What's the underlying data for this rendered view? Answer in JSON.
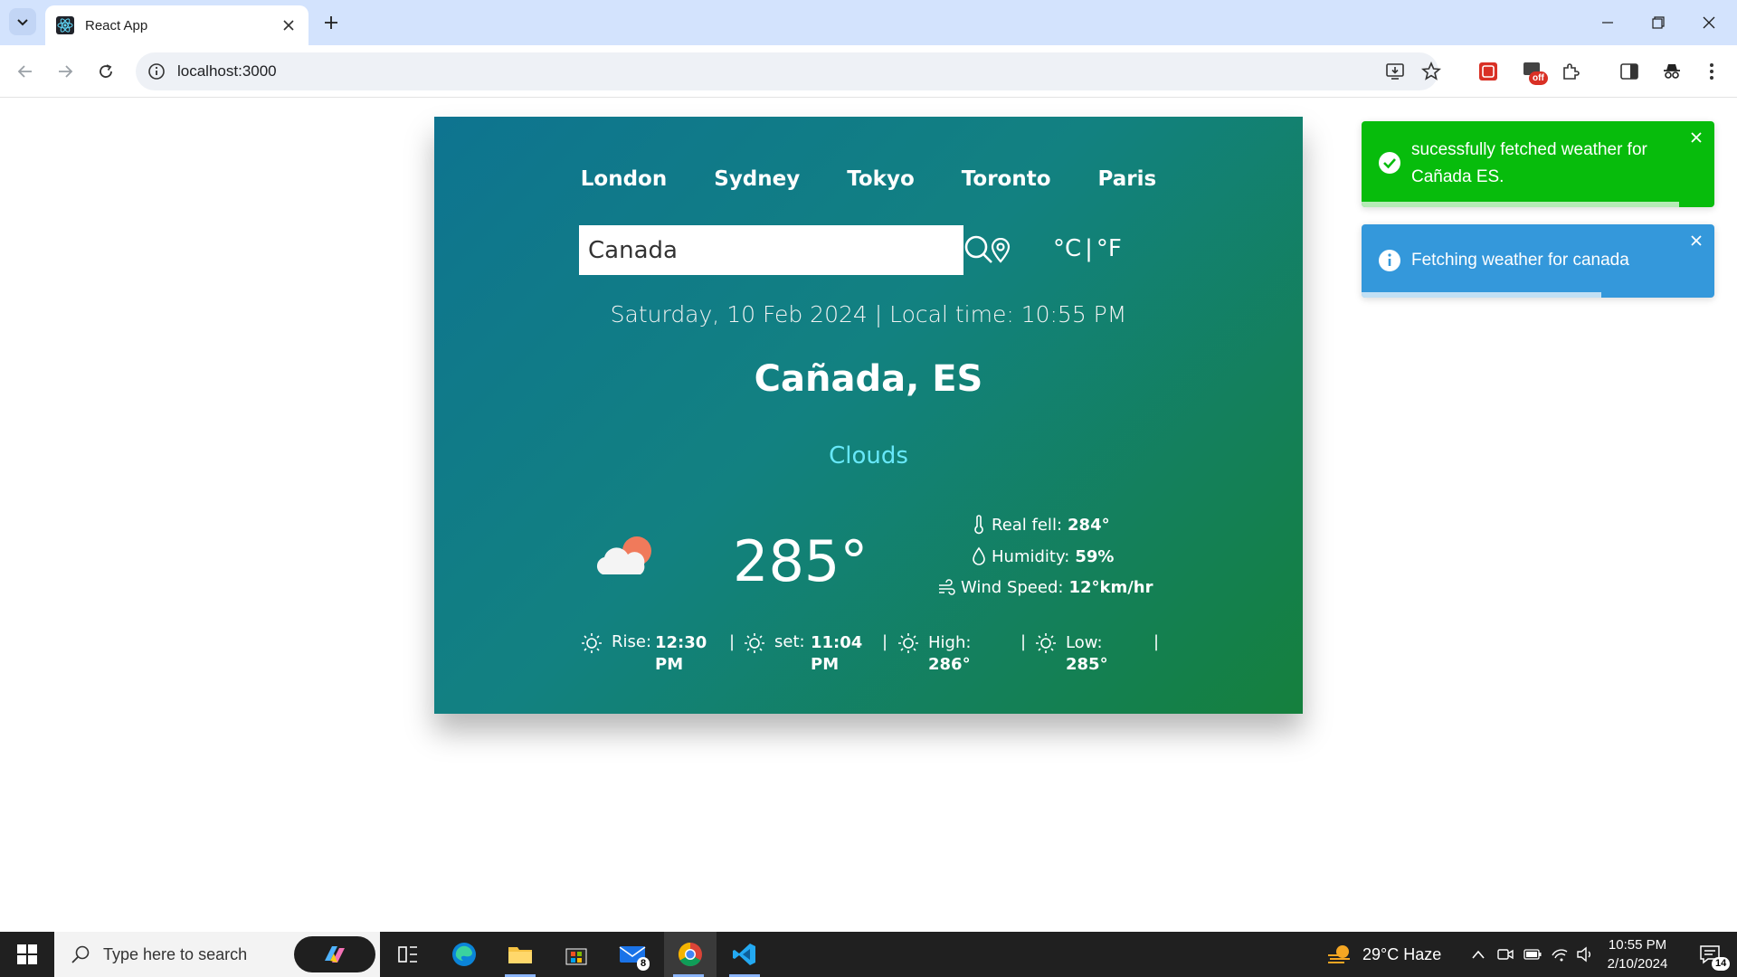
{
  "browser": {
    "tab_title": "React App",
    "url": "localhost:3000",
    "ext_badge": "off"
  },
  "app": {
    "cities": [
      "London",
      "Sydney",
      "Tokyo",
      "Toronto",
      "Paris"
    ],
    "search": {
      "value": "Canada"
    },
    "units": {
      "celsius": "°C",
      "separator": "|",
      "fahrenheit": "°F"
    },
    "datetime": "Saturday, 10 Feb 2024 | Local time: 10:55 PM",
    "location": "Cañada, ES",
    "condition": "Clouds",
    "temperature": "285°",
    "details": {
      "real_feel_label": "Real fell:",
      "real_feel_value": "284°",
      "humidity_label": "Humidity:",
      "humidity_value": "59%",
      "wind_label": "Wind Speed:",
      "wind_value": "12°km/hr"
    },
    "bottom": {
      "rise_label": "Rise:",
      "rise_value": "12:30 PM",
      "set_label": "set:",
      "set_value": "11:04 PM",
      "high_label": "High:",
      "high_value": "286°",
      "low_label": "Low:",
      "low_value": "285°",
      "separator": "|"
    },
    "colors": {
      "condition": "#67e8f9",
      "card_start": "#0e7490",
      "card_end": "#15803d"
    }
  },
  "toasts": [
    {
      "type": "success",
      "message": "sucessfully fetched weather for Cañada ES.",
      "color": "#07bc0c",
      "progress": 0.9
    },
    {
      "type": "info",
      "message": "Fetching weather for canada",
      "color": "#3498db",
      "progress": 0.8
    }
  ],
  "taskbar": {
    "search_placeholder": "Type here to search",
    "mail_badge": "8",
    "weather": "29°C Haze",
    "time": "10:55 PM",
    "date": "2/10/2024",
    "notification_count": "14"
  }
}
